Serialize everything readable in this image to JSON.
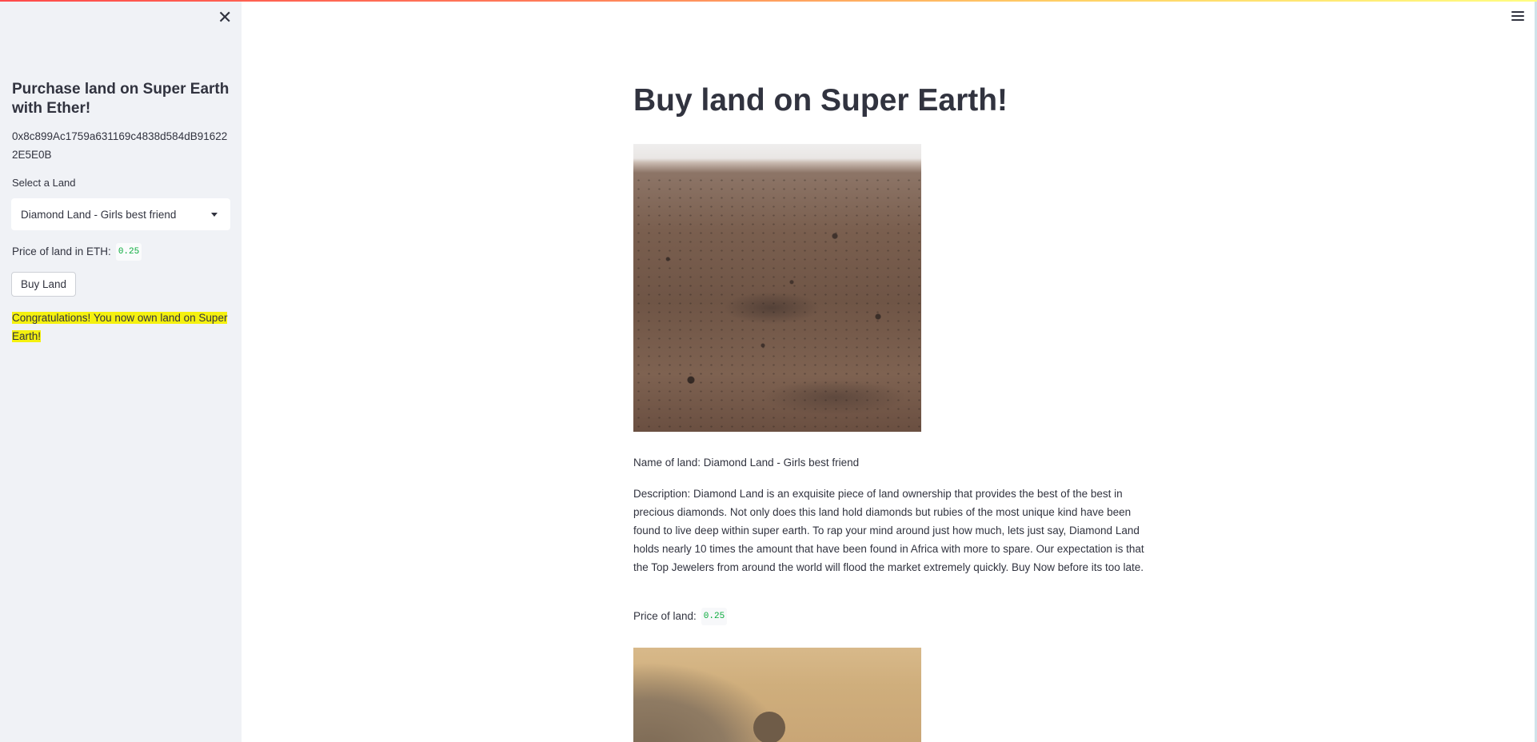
{
  "sidebar": {
    "close_label": "✕",
    "title": "Purchase land on Super Earth with Ether!",
    "account_address": "0x8c899Ac1759a631169c4838d584dB916222E5E0B",
    "select_label": "Select a Land",
    "selected_land": "Diamond Land - Girls best friend",
    "price_label": "Price of land in ETH:",
    "price_value": "0.25",
    "buy_button_label": "Buy Land",
    "success_message": "Congratulations! You now own land on Super Earth!"
  },
  "main": {
    "title": "Buy land on Super Earth!",
    "land": {
      "name_text": "Name of land: Diamond Land - Girls best friend",
      "description_text": "Description: Diamond Land is an exquisite piece of land ownership that provides the best of the best in precious diamonds. Not only does this land hold diamonds but rubies of the most unique kind have been found to live deep within super earth. To rap your mind around just how much, lets just say, Diamond Land holds nearly 10 times the amount that have been found in Africa with more to spare. Our expectation is that the Top Jewelers from around the world will flood the market extremely quickly. Buy Now before its too late.",
      "price_label": "Price of land:",
      "price_value": "0.25"
    }
  },
  "icons": {
    "menu": "hamburger-menu-icon",
    "close": "close-icon",
    "select_caret": "chevron-down-icon"
  },
  "colors": {
    "sidebar_bg": "#f0f2f6",
    "text": "#31333f",
    "code_green": "#09ab3b",
    "highlight": "#f5f10f",
    "accent_bar": "#ff4b4b"
  }
}
